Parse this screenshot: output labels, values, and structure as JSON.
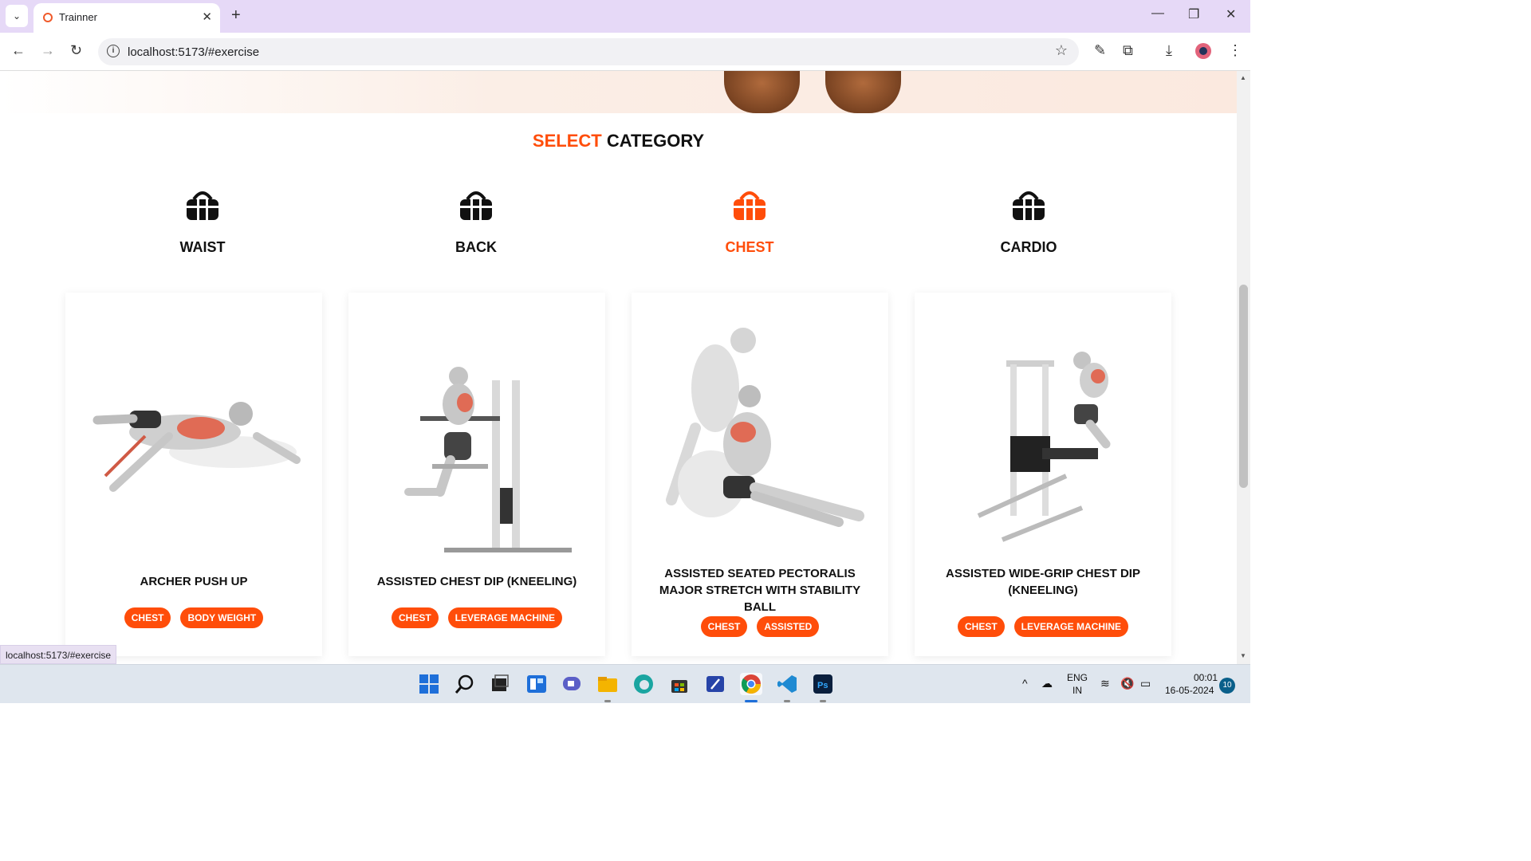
{
  "browser": {
    "tab_title": "Trainner",
    "url": "localhost:5173/#exercise",
    "status_url": "localhost:5173/#exercise"
  },
  "section": {
    "title_highlight": "SELECT",
    "title_rest": "CATEGORY"
  },
  "categories": [
    {
      "label": "WAIST",
      "active": false
    },
    {
      "label": "BACK",
      "active": false
    },
    {
      "label": "CHEST",
      "active": true
    },
    {
      "label": "CARDIO",
      "active": false
    }
  ],
  "exercises": [
    {
      "name": "ARCHER PUSH UP",
      "tags": [
        "CHEST",
        "BODY WEIGHT"
      ]
    },
    {
      "name": "ASSISTED CHEST DIP (KNEELING)",
      "tags": [
        "CHEST",
        "LEVERAGE MACHINE"
      ]
    },
    {
      "name": "ASSISTED SEATED PECTORALIS MAJOR STRETCH WITH STABILITY BALL",
      "tags": [
        "CHEST",
        "ASSISTED"
      ]
    },
    {
      "name": "ASSISTED WIDE-GRIP CHEST DIP (KNEELING)",
      "tags": [
        "CHEST",
        "LEVERAGE MACHINE"
      ]
    }
  ],
  "colors": {
    "accent": "#ff4d0a",
    "icon_default": "#111111"
  },
  "taskbar": {
    "language": "ENG",
    "region": "IN",
    "time": "00:01",
    "date": "16-05-2024",
    "notifications": "10"
  }
}
